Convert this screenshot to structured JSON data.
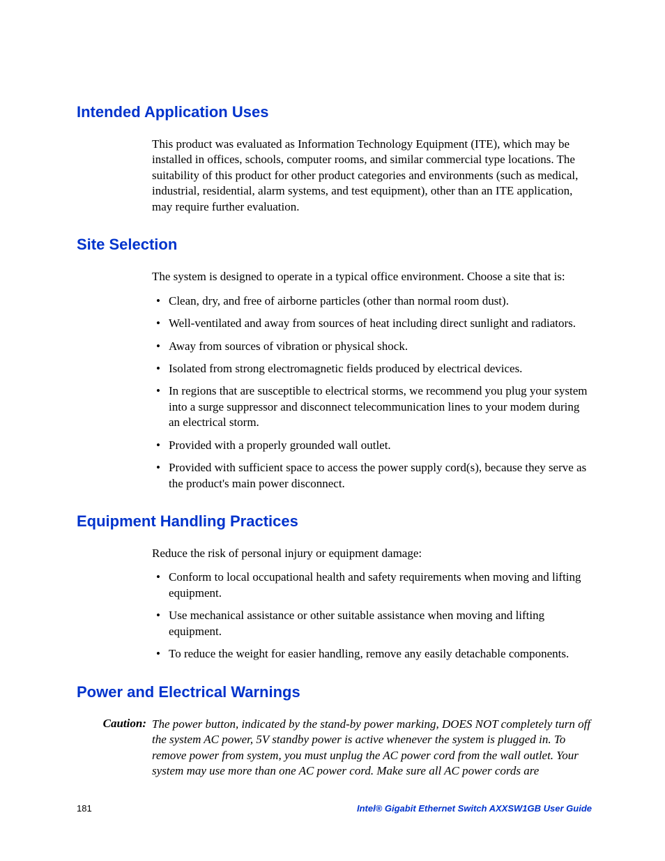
{
  "sections": {
    "intended": {
      "heading": "Intended Application Uses",
      "paragraph": "This product was evaluated as Information Technology Equipment (ITE), which may be installed in offices, schools, computer rooms, and similar commercial type locations.  The suitability of this product for other product categories and environments (such as medical, industrial, residential, alarm systems, and test equipment), other than an ITE application, may require further evaluation."
    },
    "site": {
      "heading": "Site Selection",
      "paragraph": "The system is designed to operate in a typical office environment.  Choose a site that is:",
      "bullets": [
        "Clean, dry, and free of airborne particles (other than normal room dust).",
        "Well-ventilated and away from sources of heat including direct sunlight and radiators.",
        "Away from sources of vibration or physical shock.",
        "Isolated from strong electromagnetic fields produced by electrical devices.",
        "In regions that are susceptible to electrical storms, we recommend you plug your system into a surge suppressor and disconnect telecommunication lines to your modem during an electrical storm.",
        "Provided with a properly grounded wall outlet.",
        "Provided with sufficient space to access the power supply cord(s), because they serve as the product's main power disconnect."
      ]
    },
    "equipment": {
      "heading": "Equipment Handling Practices",
      "paragraph": "Reduce the risk of personal injury or equipment damage:",
      "bullets": [
        "Conform to local occupational health and safety requirements when moving and lifting equipment.",
        "Use mechanical assistance or other suitable assistance when moving and lifting equipment.",
        "To reduce the weight for easier handling, remove any easily detachable components."
      ]
    },
    "power": {
      "heading": "Power and Electrical Warnings",
      "caution_label": "Caution:",
      "caution_text": "The power button, indicated by the stand-by power marking, DOES NOT completely turn off the system AC power, 5V standby power is active whenever the system is plugged in.  To remove power from system, you must unplug the AC power cord from the wall outlet.  Your system may use more than one AC power cord.  Make sure all AC power cords are"
    }
  },
  "footer": {
    "page": "181",
    "title": "Intel® Gigabit Ethernet Switch AXXSW1GB User Guide"
  }
}
